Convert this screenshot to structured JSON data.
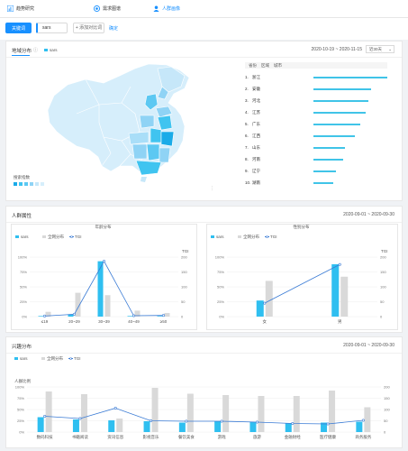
{
  "nav": {
    "items": [
      {
        "label": "趋势研究",
        "icon": "chart-icon",
        "active": false
      },
      {
        "label": "需求图谱",
        "icon": "graph-icon",
        "active": false
      },
      {
        "label": "人群画像",
        "icon": "user-icon",
        "active": true
      }
    ]
  },
  "toolbar": {
    "keyword_button": "关键词",
    "keyword_value": "sars",
    "add_compare": "+ 添加对比词",
    "confirm": "确定"
  },
  "region": {
    "title": "地域分布",
    "legend_label": "sars",
    "date_range": "2020-10-19 ~ 2020-11-15",
    "province_select": "近30天",
    "heat_title": "搜索指数",
    "table_headers": [
      "省份",
      "区域",
      "城市"
    ],
    "ranks": [
      {
        "n": "1.",
        "name": "浙江",
        "value": 100
      },
      {
        "n": "2.",
        "name": "安徽",
        "value": 78
      },
      {
        "n": "3.",
        "name": "河北",
        "value": 74
      },
      {
        "n": "4.",
        "name": "江苏",
        "value": 71
      },
      {
        "n": "5.",
        "name": "广东",
        "value": 63
      },
      {
        "n": "6.",
        "name": "江西",
        "value": 56
      },
      {
        "n": "7.",
        "name": "山东",
        "value": 43
      },
      {
        "n": "8.",
        "name": "河南",
        "value": 40
      },
      {
        "n": "9.",
        "name": "辽宁",
        "value": 30
      },
      {
        "n": "10.",
        "name": "湖南",
        "value": 27
      }
    ]
  },
  "attrs": {
    "title": "人群属性",
    "date_range": "2020-09-01 ~ 2020-09-30",
    "legend": [
      "sars",
      "全网分布",
      "TGI"
    ],
    "colors": {
      "sars": "#2fbff0",
      "all": "#d9d9d9",
      "tgi": "#3a7bd5"
    }
  },
  "interest": {
    "title": "兴趣分布",
    "date_range": "2020-09-01 ~ 2020-09-30",
    "legend": [
      "sars",
      "全网分布",
      "TGI"
    ]
  },
  "chart_data": [
    {
      "type": "bar",
      "title": "年龄分布",
      "categories": [
        "≤19",
        "20~29",
        "30~39",
        "40~49",
        "≥50"
      ],
      "ylabel": "",
      "y_ticks": [
        "100%",
        "75%",
        "50%",
        "25%",
        "0%"
      ],
      "y2_label": "TGI",
      "y2_ticks": [
        "200",
        "150",
        "100",
        "50",
        "0"
      ],
      "ylim": [
        0,
        100
      ],
      "series": [
        {
          "name": "sars",
          "values": [
            1,
            4,
            93,
            1,
            1
          ]
        },
        {
          "name": "全网分布",
          "values": [
            8,
            40,
            36,
            10,
            6
          ]
        },
        {
          "name": "TGI",
          "values": [
            2,
            8,
            186,
            3,
            4
          ]
        }
      ]
    },
    {
      "type": "bar",
      "title": "性别分布",
      "categories": [
        "女",
        "男"
      ],
      "y_ticks": [
        "100%",
        "75%",
        "50%",
        "25%",
        "0%"
      ],
      "y2_label": "TGI",
      "y2_ticks": [
        "200",
        "150",
        "100",
        "50",
        "0"
      ],
      "ylim": [
        0,
        100
      ],
      "series": [
        {
          "name": "sars",
          "values": [
            27,
            88
          ]
        },
        {
          "name": "全网分布",
          "values": [
            60,
            67
          ]
        },
        {
          "name": "TGI",
          "values": [
            45,
            175
          ]
        }
      ]
    },
    {
      "type": "bar",
      "title": "",
      "ylabel": "人群比例",
      "y_ticks": [
        "100%",
        "75%",
        "50%",
        "25%",
        "0%"
      ],
      "y2_ticks": [
        "200",
        "150",
        "100",
        "50",
        "0"
      ],
      "ylim": [
        0,
        100
      ],
      "categories": [
        "数码科技",
        "书籍阅读",
        "资讯信息",
        "影视音乐",
        "餐饮美食",
        "游戏",
        "旅游",
        "金融财经",
        "医疗健康",
        "商务服务"
      ],
      "series": [
        {
          "name": "sars",
          "values": [
            33,
            28,
            26,
            24,
            21,
            24,
            22,
            20,
            21,
            23
          ]
        },
        {
          "name": "全网分布",
          "values": [
            90,
            84,
            30,
            98,
            85,
            82,
            80,
            80,
            92,
            55
          ]
        },
        {
          "name": "TGI",
          "values": [
            70,
            60,
            106,
            50,
            48,
            48,
            44,
            38,
            36,
            52
          ]
        }
      ]
    }
  ]
}
